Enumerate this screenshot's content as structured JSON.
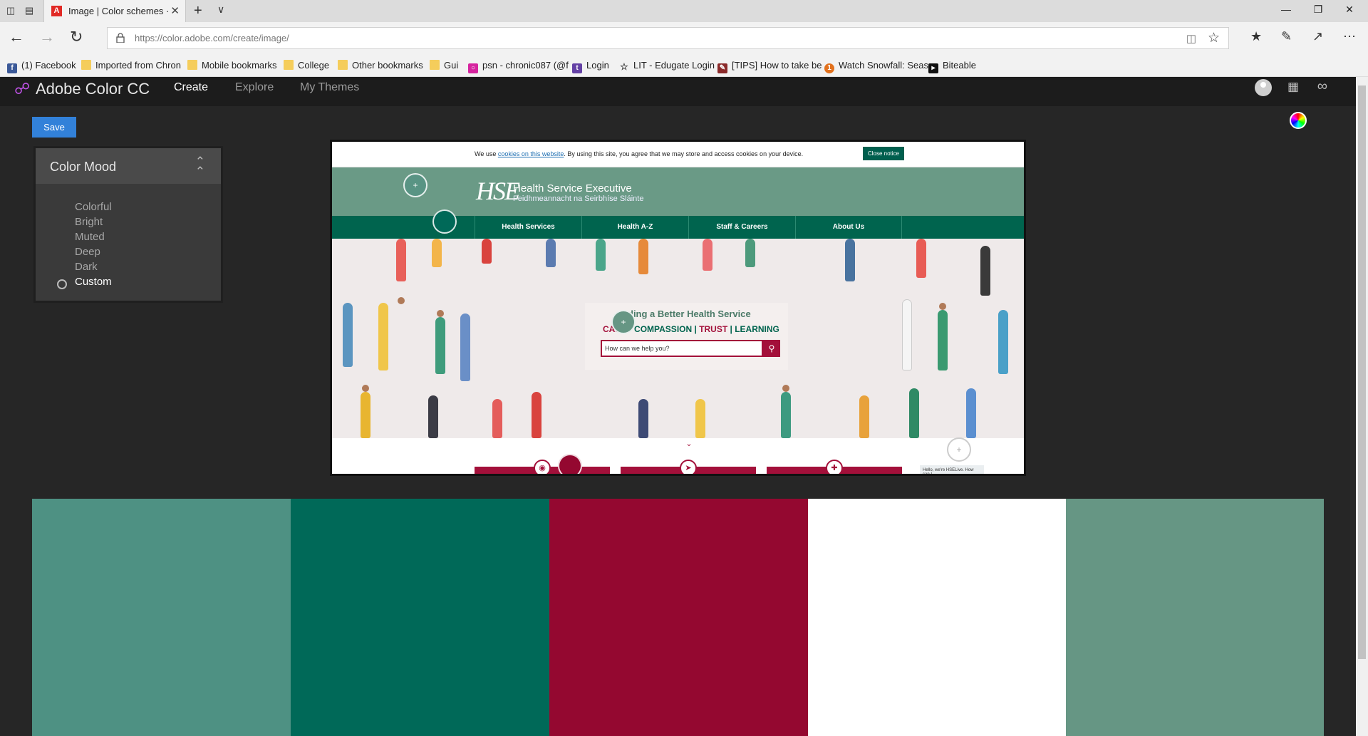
{
  "browser": {
    "tab_title": "Image | Color schemes ·",
    "url": "https://color.adobe.com/create/image/",
    "bookmarks": [
      {
        "label": "(1) Facebook",
        "icon": "facebook-icon"
      },
      {
        "label": "Imported from Chron",
        "icon": "folder-icon"
      },
      {
        "label": "Mobile bookmarks",
        "icon": "folder-icon"
      },
      {
        "label": "College",
        "icon": "folder-icon"
      },
      {
        "label": "Other bookmarks",
        "icon": "folder-icon"
      },
      {
        "label": "Gui",
        "icon": "folder-icon"
      },
      {
        "label": "psn - chronic087 (@f",
        "icon": "instagram-icon"
      },
      {
        "label": "Login",
        "icon": "twitch-icon"
      },
      {
        "label": "LIT - Edugate Login",
        "icon": "star-icon"
      },
      {
        "label": "[TIPS] How to take be",
        "icon": "tips-icon"
      },
      {
        "label": "Watch Snowfall: Seas",
        "icon": "123movies-icon"
      },
      {
        "label": "Biteable",
        "icon": "biteable-icon"
      }
    ]
  },
  "app": {
    "name": "Adobe Color CC",
    "tabs": [
      {
        "label": "Create",
        "active": true
      },
      {
        "label": "Explore",
        "active": false
      },
      {
        "label": "My Themes",
        "active": false
      }
    ],
    "save_label": "Save"
  },
  "color_mood": {
    "title": "Color Mood",
    "options": [
      "Colorful",
      "Bright",
      "Muted",
      "Deep",
      "Dark",
      "Custom"
    ],
    "selected": "Custom"
  },
  "source_image": {
    "cookie_text_before": "We use ",
    "cookie_link": "cookies on this website",
    "cookie_text_after": ". By using this site, you agree that we may store and access cookies on your device.",
    "close_notice": "Close notice",
    "org_logo": "HSE",
    "org_name": "Health Service Executive",
    "org_name_irish": "Feidhmeannacht na Seirbhíse Sláinte",
    "nav": [
      "Health Services",
      "Health A-Z",
      "Staff & Careers",
      "About Us"
    ],
    "hero_title": "ding a Better Health Service",
    "values": [
      "CARE",
      "COMPASSION",
      "TRUST",
      "LEARNING"
    ],
    "search_placeholder": "How can we help you?",
    "chat_text": "Hello, we're HSELive. How can I"
  },
  "swatches": [
    "#4e9183",
    "#006958",
    "#940830",
    "#ffffff",
    "#669684"
  ],
  "colors": {
    "header_bg": "#1c1c1c",
    "page_bg": "#262626",
    "accent": "#3281d9"
  }
}
